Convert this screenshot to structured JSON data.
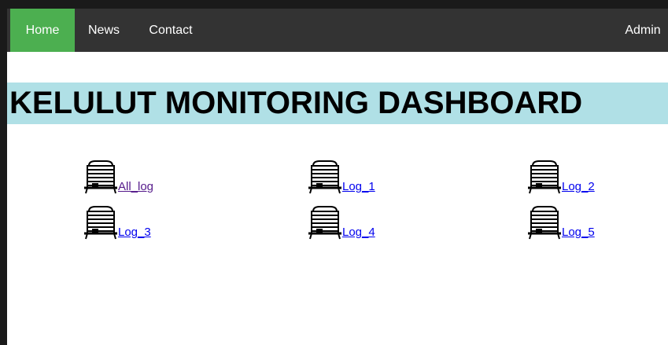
{
  "nav": {
    "home": "Home",
    "news": "News",
    "contact": "Contact",
    "admin": "Admin"
  },
  "banner": {
    "title": "KELULUT MONITORING DASHBOARD"
  },
  "logs": [
    {
      "label": "All_log",
      "icon": "beehive-icon",
      "visited": true
    },
    {
      "label": "Log_1",
      "icon": "beehive-icon",
      "visited": false
    },
    {
      "label": "Log_2",
      "icon": "beehive-icon",
      "visited": false
    },
    {
      "label": "Log_3",
      "icon": "beehive-icon",
      "visited": false
    },
    {
      "label": "Log_4",
      "icon": "beehive-icon",
      "visited": false
    },
    {
      "label": "Log_5",
      "icon": "beehive-icon",
      "visited": false
    }
  ],
  "colors": {
    "nav_bg": "#333333",
    "nav_active": "#4CAF50",
    "banner_bg": "#b0e0e6",
    "link": "#0000ee",
    "link_visited": "#551a8b"
  }
}
